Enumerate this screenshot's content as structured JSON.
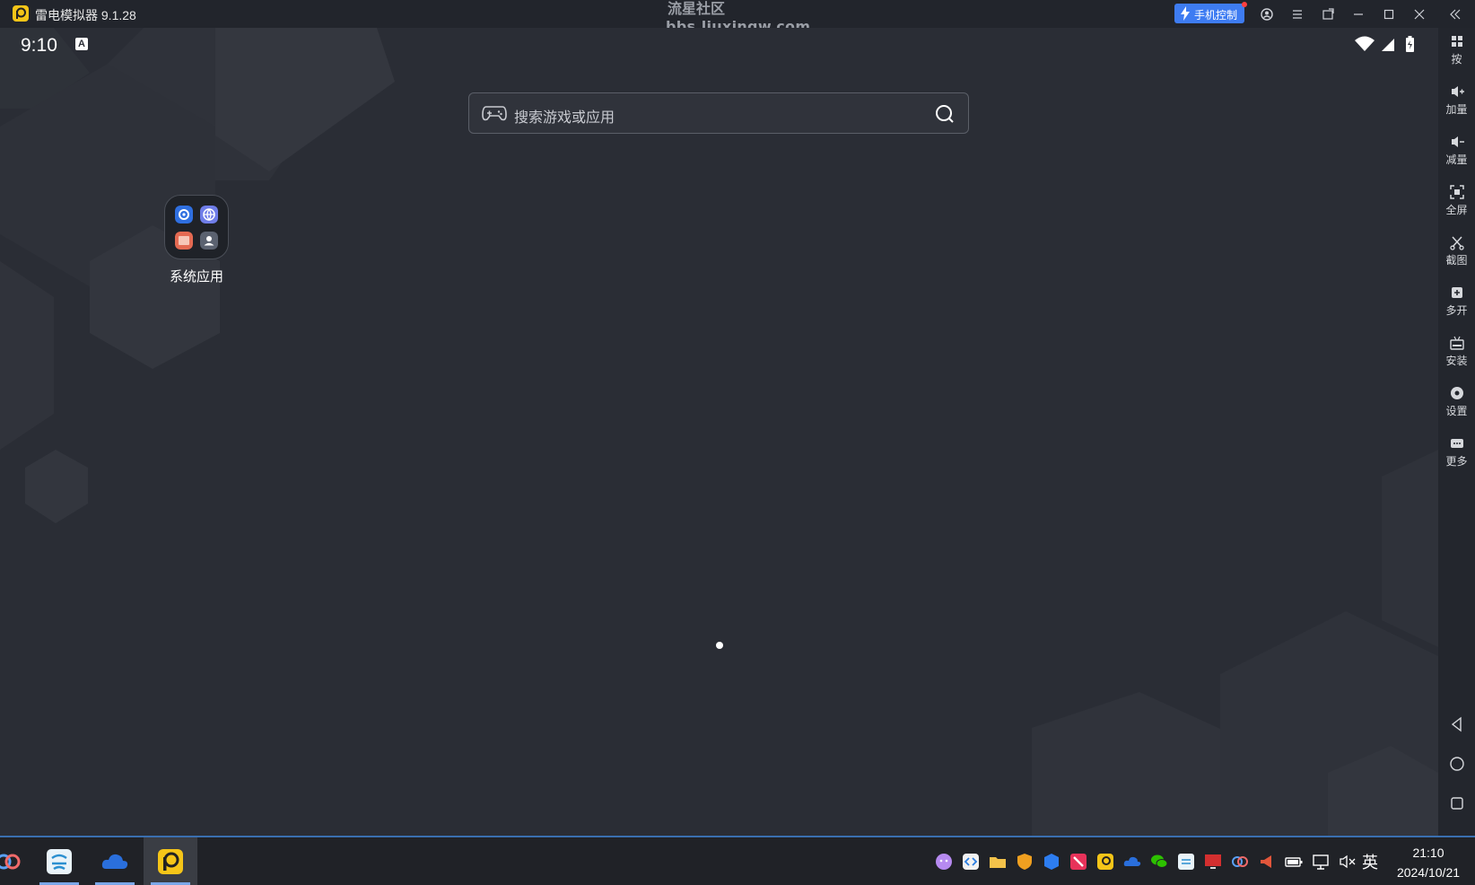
{
  "titlebar": {
    "app_title": "雷电模拟器 9.1.28",
    "watermark_line1": "流星社区",
    "watermark_line2": "bbs.liuxingw.com",
    "phone_control_label": "手机控制"
  },
  "status_bar": {
    "time": "9:10",
    "badge": "A"
  },
  "search": {
    "placeholder": "搜索游戏或应用"
  },
  "folder": {
    "label": "系统应用"
  },
  "sidebar": {
    "items": [
      {
        "label": "按",
        "icon": "grid-icon"
      },
      {
        "label": "加量",
        "icon": "volume-up-icon"
      },
      {
        "label": "减量",
        "icon": "volume-down-icon"
      },
      {
        "label": "全屏",
        "icon": "fullscreen-icon"
      },
      {
        "label": "截图",
        "icon": "scissors-icon"
      },
      {
        "label": "多开",
        "icon": "multi-open-icon"
      },
      {
        "label": "安装",
        "icon": "apk-install-icon"
      },
      {
        "label": "设置",
        "icon": "settings-icon"
      },
      {
        "label": "更多",
        "icon": "more-icon"
      }
    ]
  },
  "taskbar": {
    "ime": "英",
    "time": "21:10",
    "date": "2024/10/21"
  },
  "colors": {
    "accent": "#3e7cf2",
    "screen_bg": "#2a2d35",
    "titlebar_bg": "#22252c"
  }
}
